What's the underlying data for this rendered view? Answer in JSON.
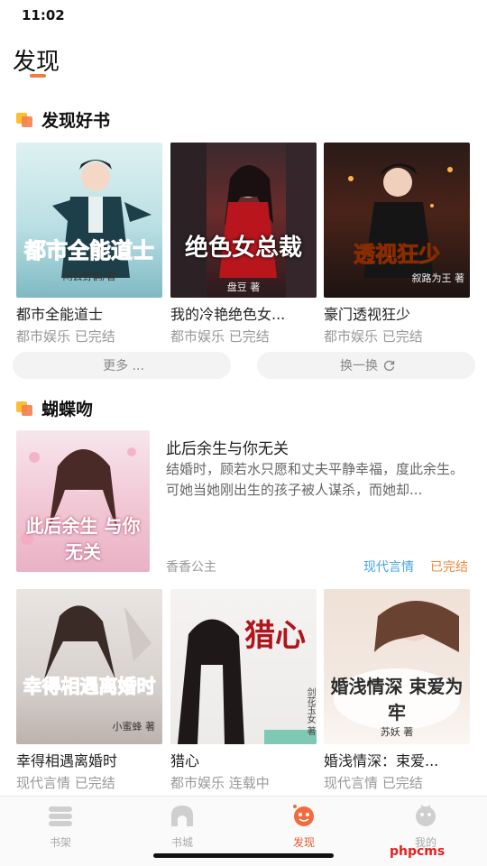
{
  "status_bar": {
    "time": "11:02"
  },
  "page": {
    "title": "发现"
  },
  "section1": {
    "title": "发现好书",
    "books": [
      {
        "name": "都市全能道士",
        "meta": "都市娱乐 已完结",
        "cover_text": "都市全能道士",
        "cover_author": "闲云野鹤/著"
      },
      {
        "name": "我的冷艳绝色女...",
        "meta": "都市娱乐 已完结",
        "cover_text": "绝色女总裁",
        "cover_author": "盘豆 著"
      },
      {
        "name": "豪门透视狂少",
        "meta": "都市娱乐 已完结",
        "cover_text": "透视狂少",
        "cover_author": "叙路为王 著"
      }
    ],
    "more_label": "更多 ...",
    "refresh_label": "换一换"
  },
  "section2": {
    "title": "蝴蝶吻",
    "feature": {
      "title": "此后余生与你无关",
      "desc": "结婚时，顾若水只愿和丈夫平静幸福，度此余生。\n可她当她刚出生的孩子被人谋杀，而她却...",
      "author": "香香公主",
      "genre": "现代言情",
      "status": "已完结",
      "cover_text": "此后余生 与你无关"
    },
    "books": [
      {
        "name": "幸得相遇离婚时",
        "meta": "现代言情 已完结",
        "cover_text": "幸得相遇离婚时",
        "cover_author": "小蜜蜂 著"
      },
      {
        "name": "猎心",
        "meta": "都市娱乐 连载中",
        "cover_text": "猎心",
        "cover_author": "剑花玉女 著"
      },
      {
        "name": "婚浅情深：束爱...",
        "meta": "现代言情 已完结",
        "cover_text": "婚浅情深 束爱为牢",
        "cover_author": "苏妖 著"
      }
    ]
  },
  "tabbar": {
    "tabs": [
      {
        "label": "书架",
        "icon": "bookshelf-icon"
      },
      {
        "label": "书城",
        "icon": "bookstore-icon"
      },
      {
        "label": "发现",
        "icon": "discover-icon"
      },
      {
        "label": "我的",
        "icon": "profile-icon"
      }
    ]
  },
  "watermark": "phpcms",
  "colors": {
    "accent": "#e8572d",
    "genre": "#4aa3df",
    "status": "#f08a3c"
  }
}
